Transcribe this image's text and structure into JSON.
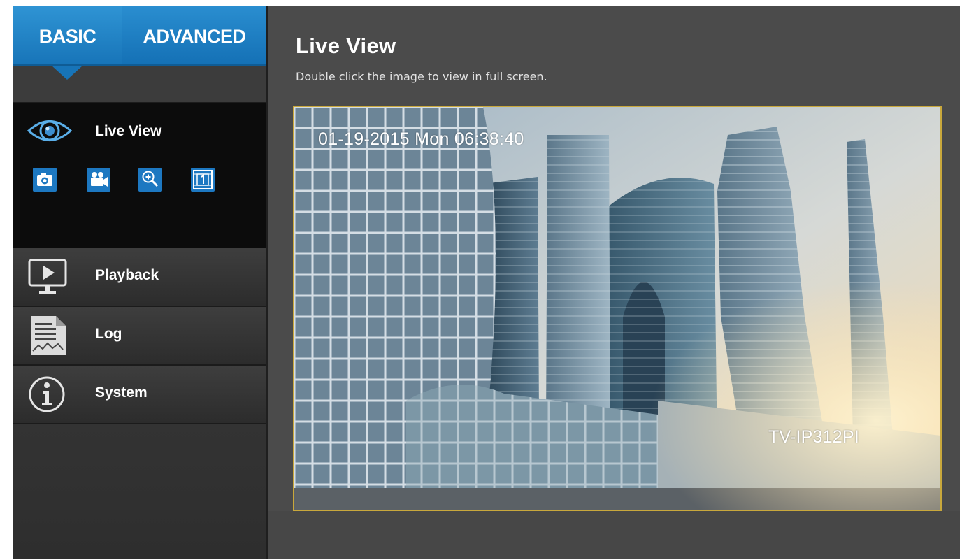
{
  "tabs": {
    "basic": "BASIC",
    "advanced": "ADVANCED",
    "active": "basic"
  },
  "sidebar": {
    "live_view": {
      "label": "Live View",
      "tools": [
        {
          "name": "snapshot",
          "icon": "camera-icon"
        },
        {
          "name": "record",
          "icon": "video-camera-icon"
        },
        {
          "name": "zoom",
          "icon": "zoom-in-icon"
        },
        {
          "name": "original-size",
          "icon": "one-to-one-icon"
        }
      ]
    },
    "items": [
      {
        "label": "Playback",
        "icon": "monitor-play-icon"
      },
      {
        "label": "Log",
        "icon": "document-log-icon"
      },
      {
        "label": "System",
        "icon": "info-icon"
      }
    ]
  },
  "main": {
    "title": "Live View",
    "subtitle": "Double click the image to view in full screen.",
    "video": {
      "osd_datetime": "01-19-2015 Mon  06:38:40",
      "osd_camera_name": "TV-IP312PI"
    }
  },
  "colors": {
    "accent": "#1d78c1",
    "frame_border": "#c9a83c",
    "sidebar_bg": "#3a3a3a",
    "main_bg": "#4b4b4b"
  }
}
